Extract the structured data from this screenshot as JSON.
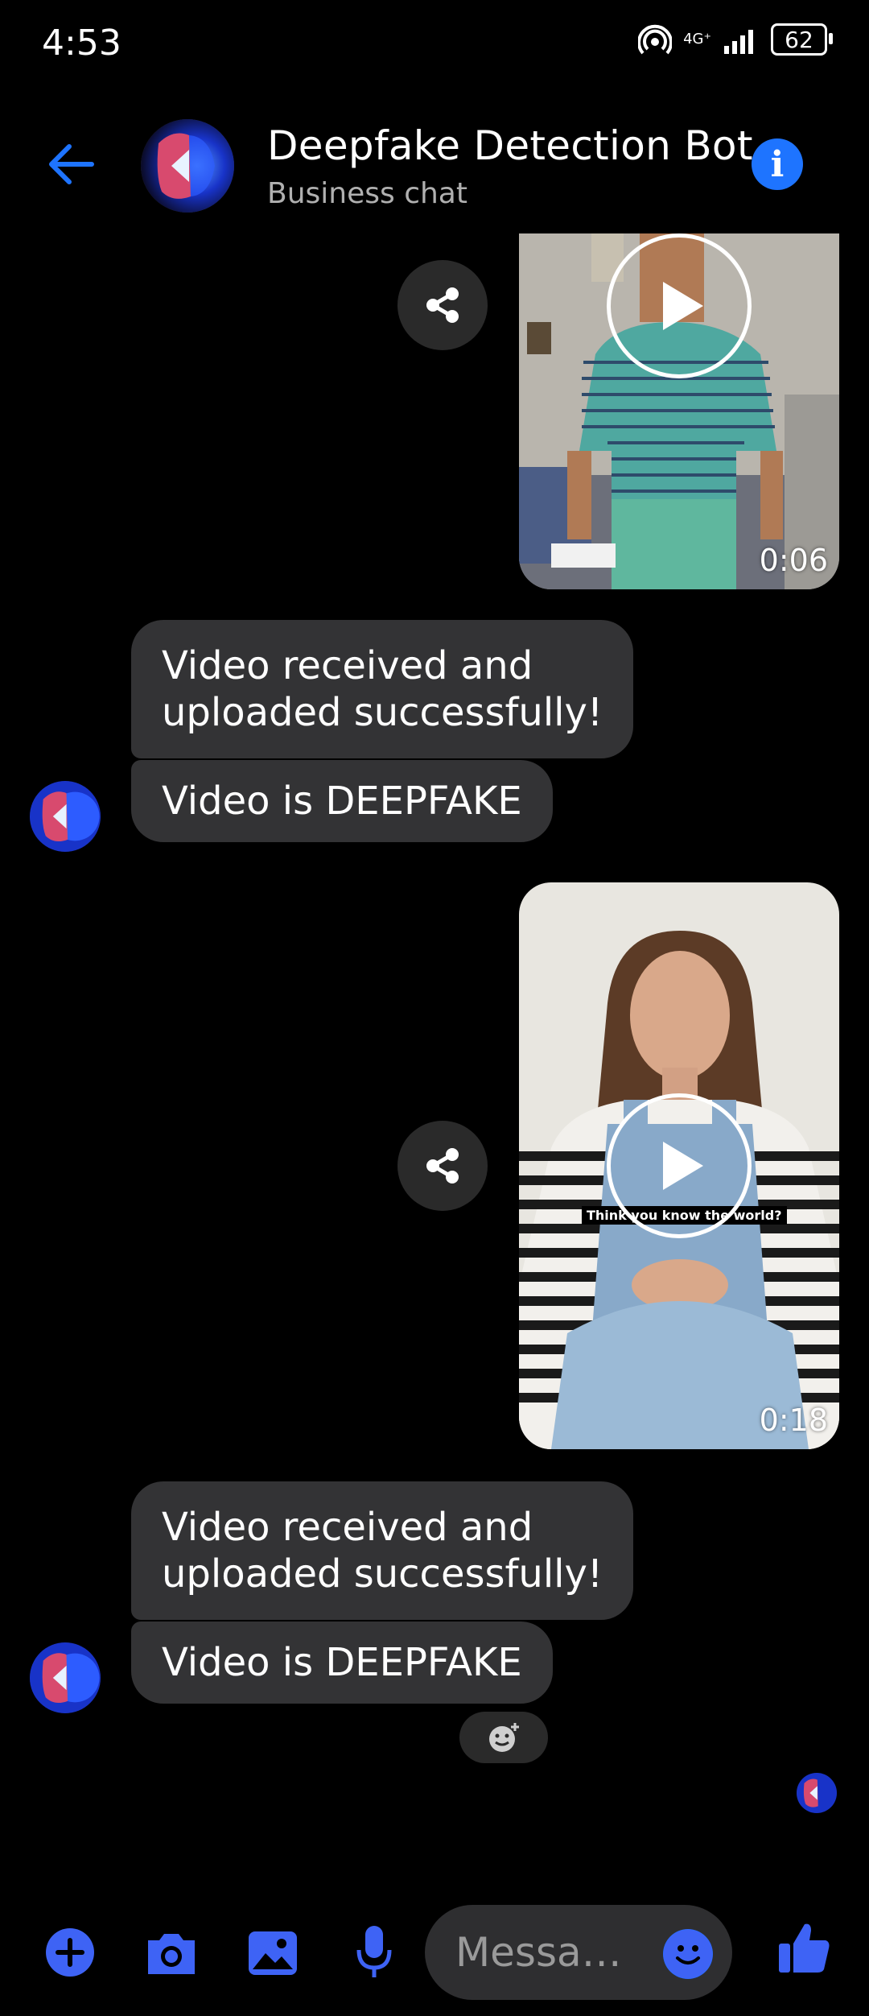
{
  "status_bar": {
    "time": "4:53",
    "network_top": "4G⁺",
    "network_bottom": "1",
    "battery": "62"
  },
  "header": {
    "title": "Deepfake Detection Bot",
    "subtitle": "Business chat"
  },
  "messages": {
    "video1_duration": "0:06",
    "group1_top": "Video received and\nuploaded successfully!",
    "group1_bottom": "Video is DEEPFAKE",
    "video2_duration": "0:18",
    "video2_caption": "Think you know the world?",
    "group2_top": "Video received and\nuploaded successfully!",
    "group2_bottom": "Video is DEEPFAKE"
  },
  "composer": {
    "placeholder": "Messa…"
  },
  "colors": {
    "accent": "#1e74ff",
    "composer_icons": "#3e63f5",
    "bubble": "#333335",
    "background": "#000000"
  }
}
